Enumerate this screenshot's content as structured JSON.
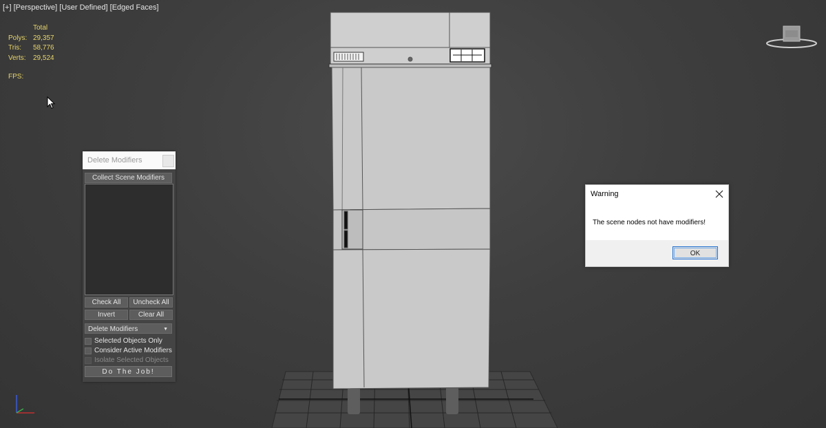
{
  "viewport": {
    "labels": [
      "[+]",
      "[Perspective]",
      "[User Defined]",
      "[Edged Faces]"
    ]
  },
  "stats": {
    "header": "Total",
    "rows": [
      {
        "label": "Polys:",
        "value": "29,357"
      },
      {
        "label": "Tris:",
        "value": "58,776"
      },
      {
        "label": "Verts:",
        "value": "29,524"
      }
    ],
    "fps_label": "FPS:"
  },
  "delete_modifiers": {
    "title": "Delete Modifiers",
    "collect_label": "Collect Scene Modifiers",
    "check_all_label": "Check All",
    "uncheck_all_label": "Uncheck All",
    "invert_label": "Invert",
    "clear_all_label": "Clear All",
    "mode_select": "Delete Modifiers",
    "options": {
      "selected_only": "Selected Objects Only",
      "consider_active": "Consider Active Modifiers",
      "isolate_selected": "Isolate Selected Objects"
    },
    "do_job_label": "Do The Job!"
  },
  "warning_dialog": {
    "title": "Warning",
    "message": "The scene nodes not have modifiers!",
    "ok_label": "OK"
  },
  "colors": {
    "stats_text": "#e8d56a",
    "viewport_bg": "#3e3e3e",
    "fridge_body": "#c9c9c9",
    "ok_focus_border": "#1f6fd0"
  },
  "icons": {
    "cursor": "arrow-cursor-icon",
    "nav_cube": "viewcube-icon",
    "axis": "axis-tripod-icon",
    "close": "close-x-icon",
    "dropdown": "dropdown-arrow-icon"
  }
}
